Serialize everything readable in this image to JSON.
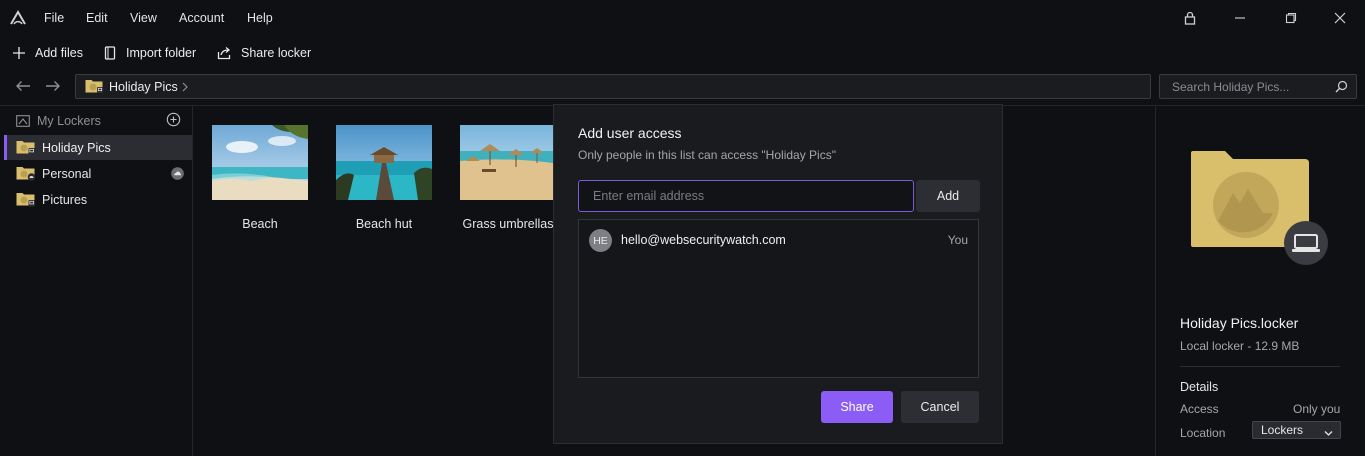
{
  "menu": {
    "file": "File",
    "edit": "Edit",
    "view": "View",
    "account": "Account",
    "help": "Help"
  },
  "toolbar": {
    "add_files": "Add files",
    "import_folder": "Import folder",
    "share_locker": "Share locker"
  },
  "address": {
    "current": "Holiday Pics",
    "search_placeholder": "Search Holiday Pics..."
  },
  "sidebar": {
    "header": "My Lockers",
    "items": [
      {
        "label": "Holiday Pics",
        "active": true,
        "badge": "laptop"
      },
      {
        "label": "Personal",
        "active": false,
        "badge": "cloud"
      },
      {
        "label": "Pictures",
        "active": false,
        "badge": "laptop"
      }
    ]
  },
  "files": [
    {
      "label": "Beach"
    },
    {
      "label": "Beach hut"
    },
    {
      "label": "Grass umbrellas"
    }
  ],
  "dialog": {
    "title": "Add user access",
    "subtitle": "Only people in this list can access \"Holiday Pics\"",
    "email_placeholder": "Enter email address",
    "add_label": "Add",
    "users": [
      {
        "initials": "HE",
        "email": "hello@websecuritywatch.com",
        "role": "You"
      }
    ],
    "share_label": "Share",
    "cancel_label": "Cancel"
  },
  "details": {
    "name": "Holiday Pics.locker",
    "meta": "Local locker - 12.9 MB",
    "section": "Details",
    "access_label": "Access",
    "access_value": "Only you",
    "location_label": "Location",
    "location_value": "Lockers"
  },
  "colors": {
    "accent": "#8b5cf6",
    "folder": "#d9bf6c",
    "background": "#0f1014"
  }
}
